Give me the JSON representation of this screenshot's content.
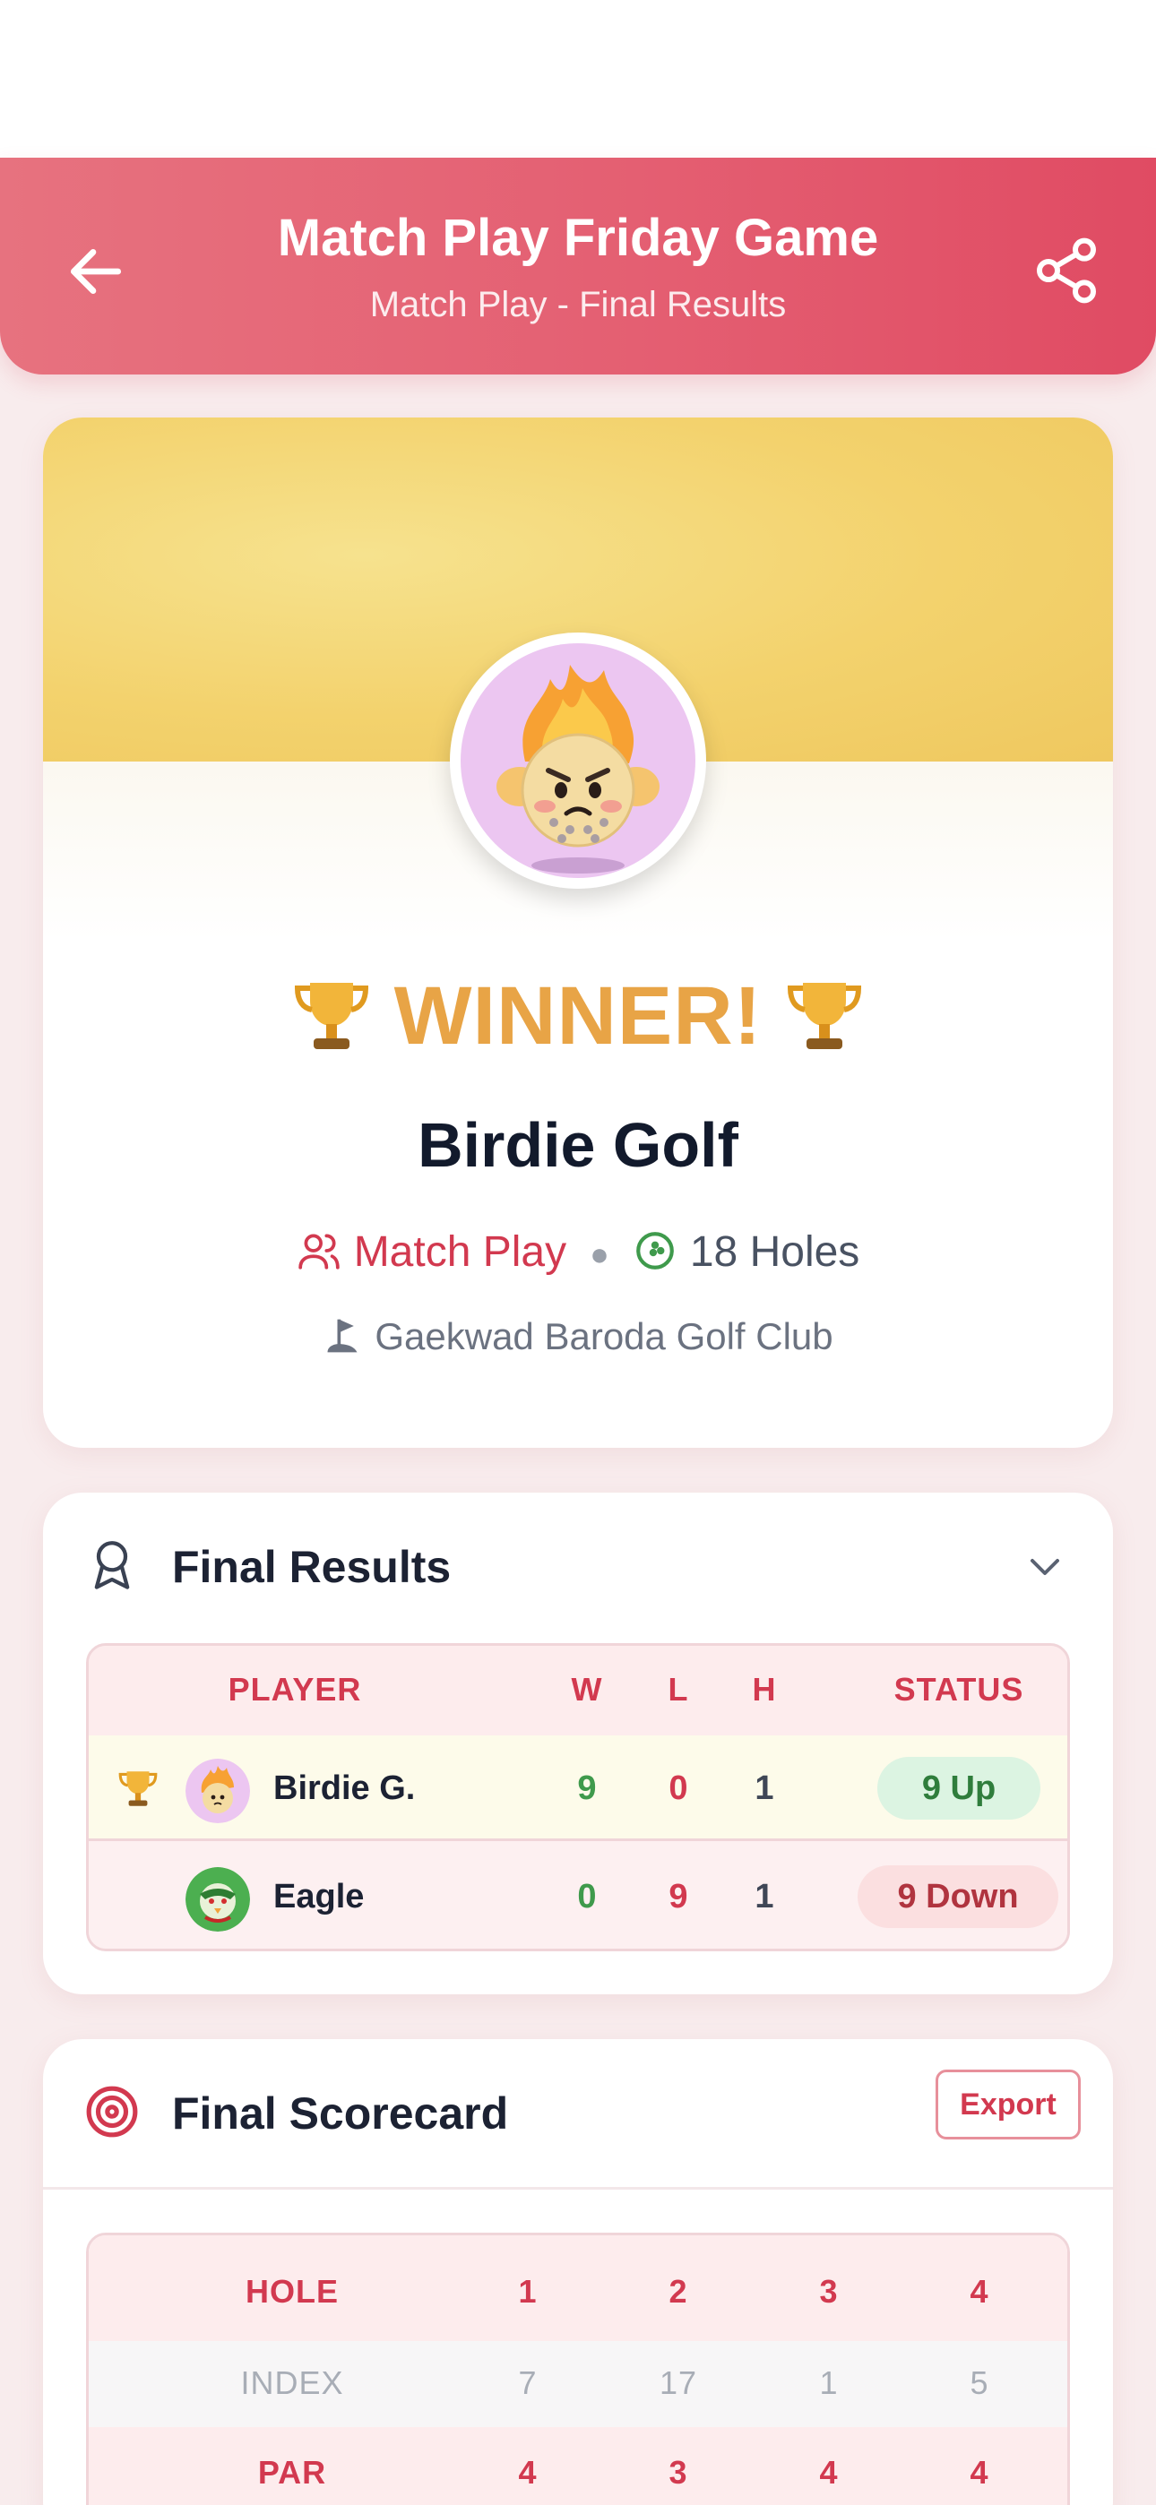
{
  "header": {
    "title": "Match Play Friday Game",
    "subtitle": "Match Play - Final Results",
    "back_icon": "arrow-left-icon",
    "share_icon": "share-icon",
    "color_start": "#e7727f",
    "color_end": "#e04b63"
  },
  "winner": {
    "label": "WINNER!",
    "name": "Birdie Golf",
    "mode": "Match Play",
    "holes": "18 Holes",
    "club": "Gaekwad Baroda Golf Club",
    "accent": "#e8a446"
  },
  "results": {
    "title": "Final Results",
    "columns": [
      "PLAYER",
      "W",
      "L",
      "H",
      "STATUS"
    ],
    "rows": [
      {
        "player": "Birdie G.",
        "w": "9",
        "l": "0",
        "h": "1",
        "status": "9 Up",
        "is_winner": true
      },
      {
        "player": "Eagle",
        "w": "0",
        "l": "9",
        "h": "1",
        "status": "9 Down",
        "is_winner": false
      }
    ]
  },
  "scorecard": {
    "title": "Final Scorecard",
    "export_label": "Export",
    "hole_label": "HOLE",
    "index_label": "INDEX",
    "par_label": "PAR",
    "holes": [
      "1",
      "2",
      "3",
      "4"
    ],
    "index": [
      "7",
      "17",
      "1",
      "5"
    ],
    "par": [
      "4",
      "3",
      "4",
      "4"
    ]
  }
}
